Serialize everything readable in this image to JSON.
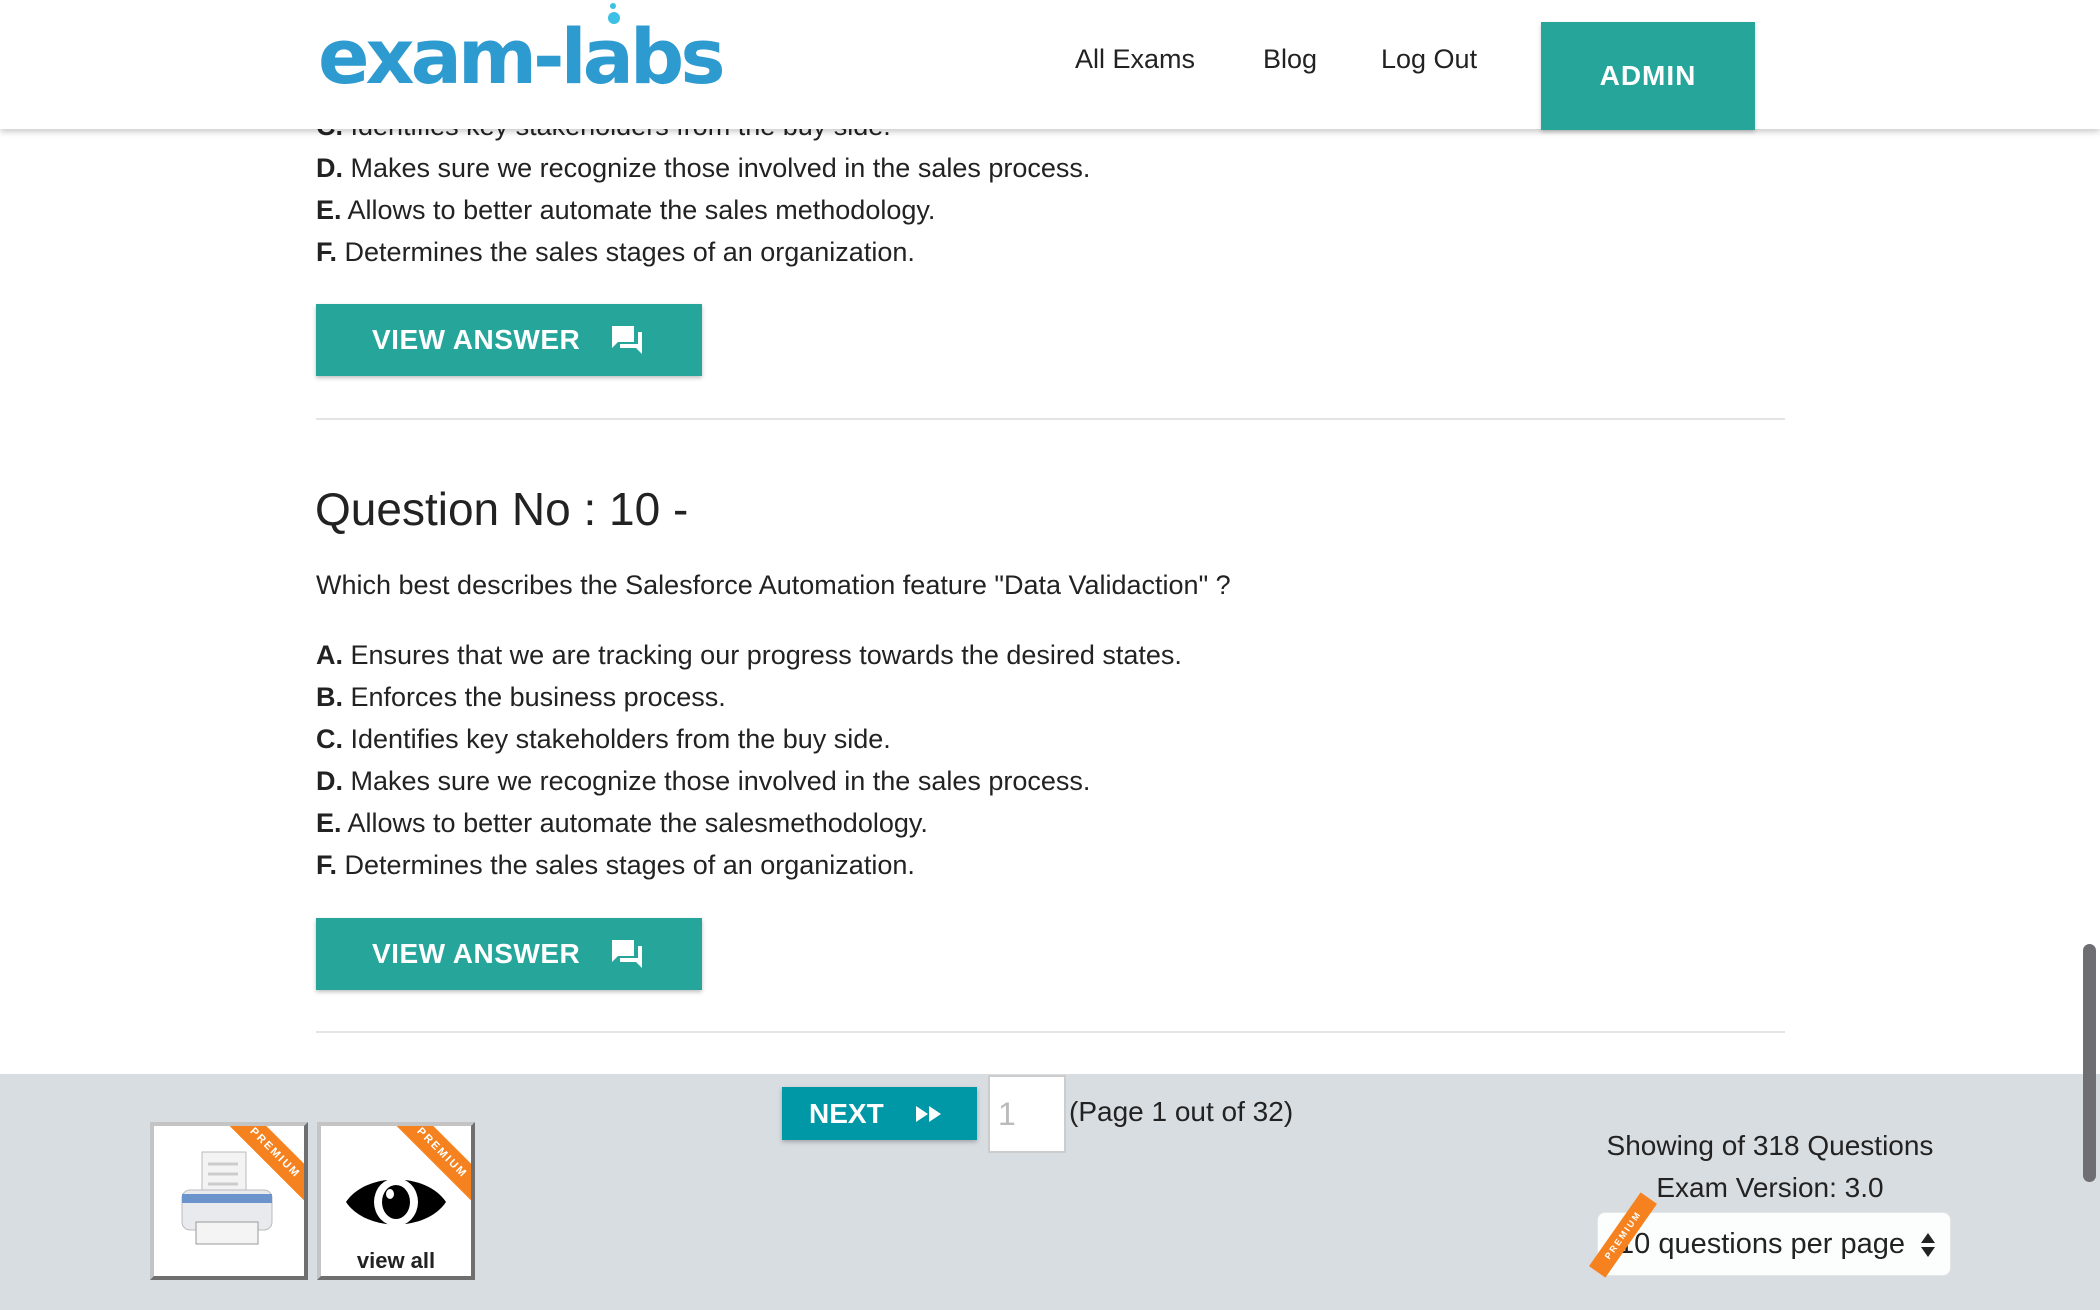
{
  "header": {
    "logo_text": "exam-labs",
    "nav": [
      "All Exams",
      "Blog",
      "Log Out"
    ],
    "admin_label": "ADMIN"
  },
  "previous_question": {
    "options": [
      {
        "letter": "C.",
        "text": "Identifies key stakeholders from the buy side."
      },
      {
        "letter": "D.",
        "text": "Makes sure we recognize those involved in the sales process."
      },
      {
        "letter": "E.",
        "text": "Allows to better automate the sales methodology."
      },
      {
        "letter": "F.",
        "text": "Determines the sales stages of an organization."
      }
    ],
    "view_answer_label": "VIEW ANSWER"
  },
  "question": {
    "title": "Question No : 10 -",
    "text": "Which best describes the Salesforce Automation feature \"Data Validaction\" ?",
    "options": [
      {
        "letter": "A.",
        "text": "Ensures that we are tracking our progress towards the desired states."
      },
      {
        "letter": "B.",
        "text": "Enforces the business process."
      },
      {
        "letter": "C.",
        "text": "Identifies key stakeholders from the buy side."
      },
      {
        "letter": "D.",
        "text": "Makes sure we recognize those involved in the sales process."
      },
      {
        "letter": "E.",
        "text": "Allows to better automate the salesmethodology."
      },
      {
        "letter": "F.",
        "text": "Determines the sales stages of an organization."
      }
    ],
    "view_answer_label": "VIEW ANSWER"
  },
  "footer": {
    "next_label": "NEXT",
    "page_input_value": "1",
    "page_text": "(Page 1 out of 32)",
    "premium_label": "PREMIUM",
    "view_all_label": "view all",
    "showing_text": "Showing of 318 Questions",
    "exam_version": "Exam Version: 3.0",
    "per_page_selected": "10 questions per page"
  },
  "colors": {
    "accent": "#26a69a",
    "next": "#0097a7",
    "premium": "#f5821f",
    "logo": "#2e9bd0",
    "footer_bg": "#d8dde1"
  }
}
